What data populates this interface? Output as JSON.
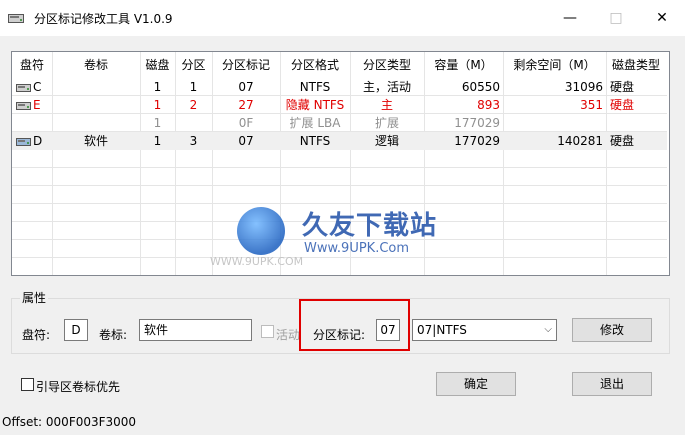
{
  "window": {
    "title": "分区标记修改工具 V1.0.9",
    "minimize": "—",
    "maximize": "□",
    "close": "✕"
  },
  "table": {
    "columns": [
      "盘符",
      "卷标",
      "磁盘",
      "分区",
      "分区标记",
      "分区格式",
      "分区类型",
      "容量（M）",
      "剩余空间（M）",
      "磁盘类型"
    ],
    "rows": [
      {
        "drive": "C",
        "label": "",
        "disk": "1",
        "part": "1",
        "mark": "07",
        "format": "NTFS",
        "ptype": "主，活动",
        "capacity": "60550",
        "free": "31096",
        "dtype": "硬盘",
        "style": "normal"
      },
      {
        "drive": "E",
        "label": "",
        "disk": "1",
        "part": "2",
        "mark": "27",
        "format": "隐藏 NTFS",
        "ptype": "主",
        "capacity": "893",
        "free": "351",
        "dtype": "硬盘",
        "style": "red"
      },
      {
        "drive": "",
        "label": "",
        "disk": "1",
        "part": "",
        "mark": "0F",
        "format": "扩展 LBA",
        "ptype": "扩展",
        "capacity": "177029",
        "free": "",
        "dtype": "",
        "style": "gray"
      },
      {
        "drive": "D",
        "label": "软件",
        "disk": "1",
        "part": "3",
        "mark": "07",
        "format": "NTFS",
        "ptype": "逻辑",
        "capacity": "177029",
        "free": "140281",
        "dtype": "硬盘",
        "style": "selected"
      }
    ]
  },
  "watermark": {
    "title": "久友下载站",
    "url": "Www.9UPK.Com",
    "left_text": "WWW.9UPK.COM"
  },
  "attributes": {
    "group_title": "属性",
    "drive_label": "盘符:",
    "drive_value": "D",
    "volume_label": "卷标:",
    "volume_value": "软件",
    "active_label": "活动",
    "mark_label": "分区标记:",
    "mark_value": "07",
    "type_select": "07|NTFS",
    "modify_button": "修改"
  },
  "options": {
    "boot_label_first": "引导区卷标优先"
  },
  "buttons": {
    "ok": "确定",
    "exit": "退出"
  },
  "status": {
    "offset": "Offset: 000F003F3000"
  },
  "colors": {
    "accent_red": "#e00000",
    "gray_text": "#909090",
    "highlight_box": "#e00000"
  }
}
